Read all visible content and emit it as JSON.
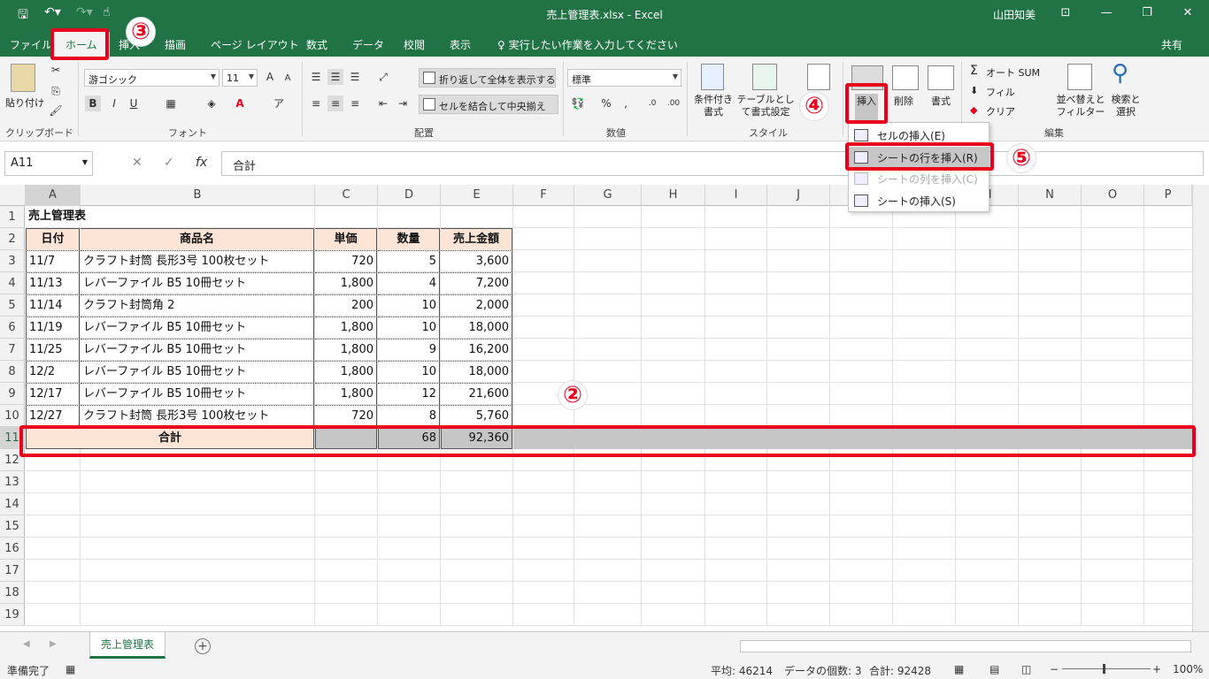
{
  "window": {
    "title": "売上管理表.xlsx  -  Excel",
    "user": "山田知美",
    "controls": [
      "⊡",
      "—",
      "❐",
      "✕"
    ]
  },
  "tabs": {
    "items": [
      "ファイル",
      "ホーム",
      "挿入",
      "描画",
      "ページ レイアウト",
      "数式",
      "データ",
      "校閲",
      "表示"
    ],
    "tell_me": "♀ 実行したい作業を入力してください",
    "share": "共有"
  },
  "ribbon": {
    "clipboard": {
      "paste": "貼り付け",
      "label": "クリップボード"
    },
    "font": {
      "name": "游ゴシック",
      "size": "11",
      "bold": "B",
      "italic": "I",
      "underline": "U",
      "label": "フォント"
    },
    "alignment": {
      "wrap": "折り返して全体を表示する",
      "merge": "セルを結合して中央揃え",
      "label": "配置"
    },
    "number": {
      "format": "標準",
      "label": "数値"
    },
    "styles": {
      "conditional": "条件付き書式",
      "table": "テーブルとして書式設定",
      "label": "スタイル"
    },
    "cells": {
      "insert": "挿入",
      "delete": "削除",
      "format": "書式"
    },
    "editing": {
      "autosum": "オート SUM",
      "fill": "フィル",
      "clear": "クリア",
      "sort": "並べ替えとフィルター",
      "find": "検索と選択",
      "label": "編集"
    }
  },
  "insert_menu": [
    {
      "label": "セルの挿入(E)",
      "disabled": false
    },
    {
      "label": "シートの行を挿入(R)",
      "disabled": false
    },
    {
      "label": "シートの列を挿入(C)",
      "disabled": true
    },
    {
      "label": "シートの挿入(S)",
      "disabled": false
    }
  ],
  "formula_bar": {
    "name_box": "A11",
    "formula": "合計",
    "fx": "fx"
  },
  "columns": [
    "A",
    "B",
    "C",
    "D",
    "E",
    "F",
    "G",
    "H",
    "I",
    "J",
    "K",
    "L",
    "M",
    "N",
    "O",
    "P"
  ],
  "rows": [
    "1",
    "2",
    "3",
    "4",
    "5",
    "6",
    "7",
    "8",
    "9",
    "10",
    "11",
    "12",
    "13",
    "14",
    "15",
    "16",
    "17",
    "18",
    "19"
  ],
  "sheet": {
    "title": "売上管理表",
    "headers": [
      "日付",
      "商品名",
      "単価",
      "数量",
      "売上金額"
    ],
    "data": [
      [
        "11/7",
        "クラフト封筒 長形3号 100枚セット",
        "720",
        "5",
        "3,600"
      ],
      [
        "11/13",
        "レバーファイル B5 10冊セット",
        "1,800",
        "4",
        "7,200"
      ],
      [
        "11/14",
        "クラフト封筒角 2",
        "200",
        "10",
        "2,000"
      ],
      [
        "11/19",
        "レバーファイル B5 10冊セット",
        "1,800",
        "10",
        "18,000"
      ],
      [
        "11/25",
        "レバーファイル B5 10冊セット",
        "1,800",
        "9",
        "16,200"
      ],
      [
        "12/2",
        "レバーファイル B5 10冊セット",
        "1,800",
        "10",
        "18,000"
      ],
      [
        "12/17",
        "レバーファイル B5 10冊セット",
        "1,800",
        "12",
        "21,600"
      ],
      [
        "12/27",
        "クラフト封筒 長形3号 100枚セット",
        "720",
        "8",
        "5,760"
      ]
    ],
    "total": {
      "label": "合計",
      "qty": "68",
      "sales": "92,360"
    }
  },
  "sheet_tab": "売上管理表",
  "status": {
    "ready": "準備完了",
    "average": "平均: 46214",
    "count": "データの個数: 3",
    "sum": "合計: 92428",
    "zoom": "100%"
  },
  "annotations": [
    "②",
    "③",
    "④",
    "⑤"
  ],
  "colors": {
    "excel_green": "#217346",
    "annotation_red": "#e8001c",
    "header_fill": "#fce4d6"
  }
}
